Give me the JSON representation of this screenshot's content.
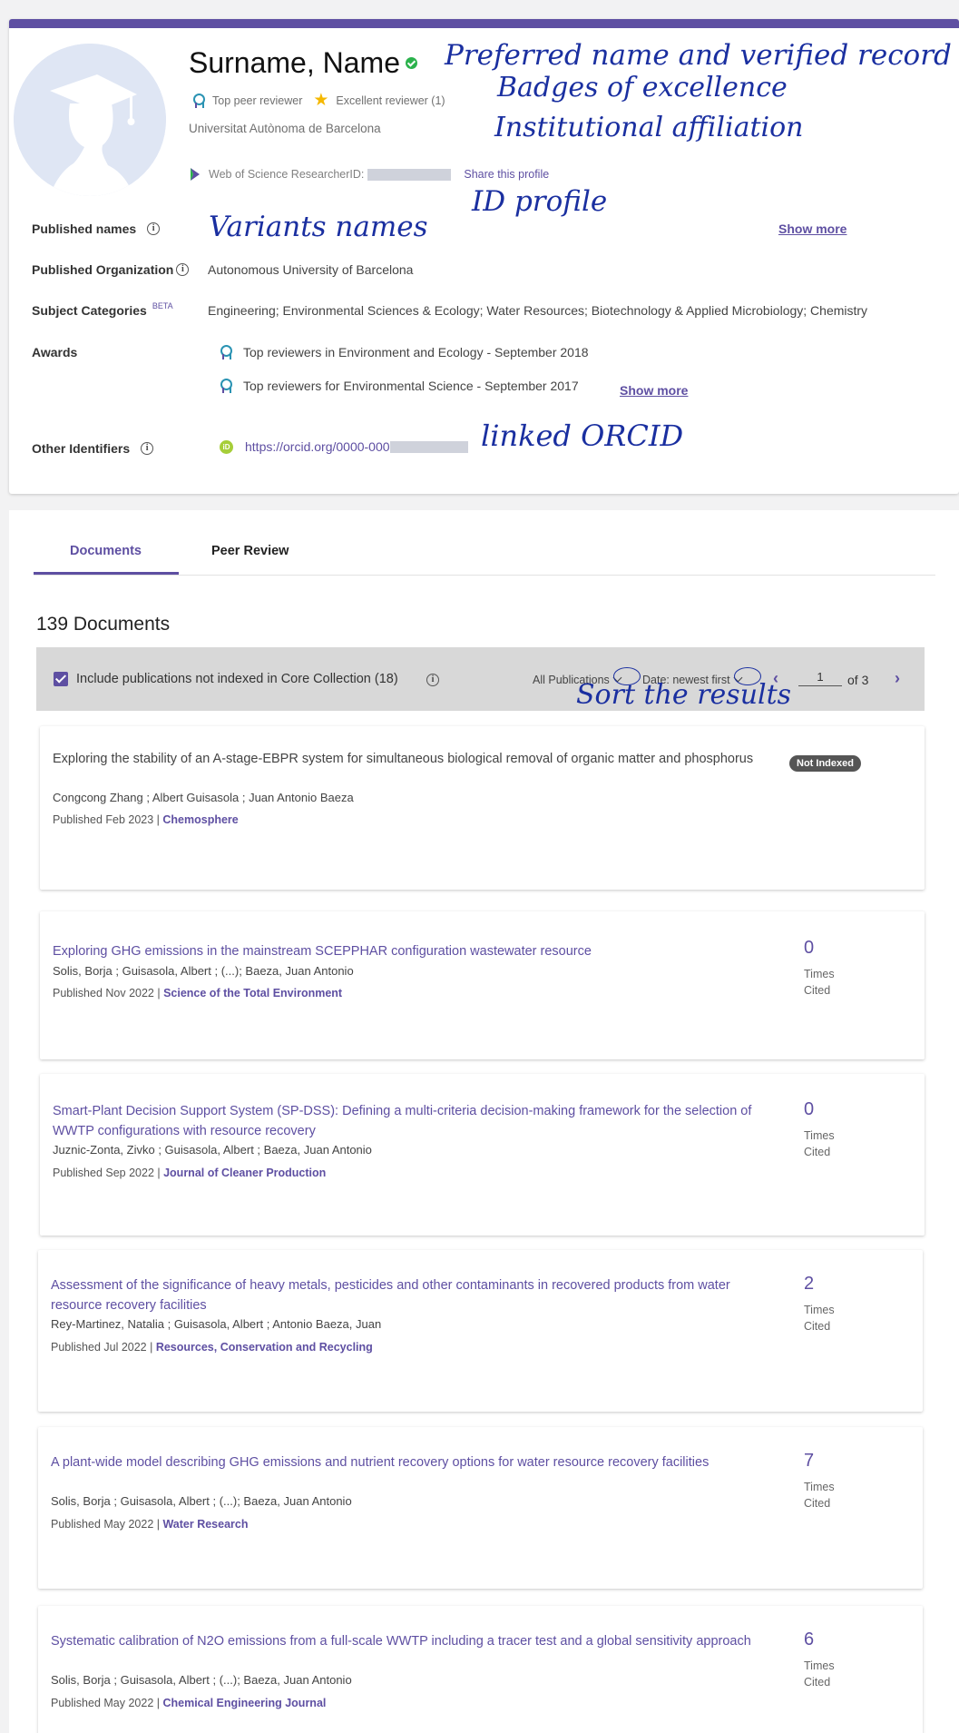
{
  "profile": {
    "name": "Surname, Name",
    "badges": {
      "top_peer": "Top peer reviewer",
      "excellent": "Excellent reviewer (1)"
    },
    "affiliation": "Universitat Autònoma de Barcelona",
    "researcher_id_label": "Web of Science ResearcherID:",
    "share": "Share this profile"
  },
  "details": {
    "published_names_label": "Published names",
    "published_org_label": "Published Organization",
    "published_org_value": "Autonomous University of Barcelona",
    "subject_label": "Subject Categories",
    "beta": "BETA",
    "subjects": "Engineering;  Environmental Sciences & Ecology;  Water Resources;  Biotechnology & Applied Microbiology;  Chemistry",
    "awards_label": "Awards",
    "awards": [
      "Top reviewers in Environment and Ecology - September 2018",
      "Top reviewers for Environmental Science - September 2017"
    ],
    "other_ids_label": "Other Identifiers",
    "orcid_icon": "iD",
    "orcid": "https://orcid.org/0000-000",
    "show_more": "Show more"
  },
  "annotations": {
    "preferred": "Preferred name and verified record",
    "badges": "Badges of excellence",
    "institutional": "Institutional affiliation",
    "id_profile": "ID profile",
    "variants": "Variants names",
    "orcid": "linked ORCID",
    "sort": "Sort the results"
  },
  "tabs": {
    "documents": "Documents",
    "peer_review": "Peer Review"
  },
  "documents": {
    "count": "139 Documents",
    "include_label": "Include publications not indexed in Core Collection (18)",
    "filter": "All Publications",
    "sort": "Date: newest first",
    "page": "1",
    "page_of": "of 3",
    "prev": "‹",
    "next": "›",
    "times": "Times",
    "cited": "Cited",
    "not_indexed": "Not Indexed",
    "items": [
      {
        "title": "Exploring the stability of an A-stage-EBPR system for simultaneous biological removal of organic matter and phosphorus",
        "authors": "Congcong Zhang ; Albert Guisasola ; Juan Antonio Baeza",
        "published": "Published Feb 2023 | ",
        "journal": "Chemosphere"
      },
      {
        "title": "Exploring GHG emissions in the mainstream SCEPPHAR configuration wastewater resource",
        "authors": "Solis, Borja ; Guisasola, Albert ; (...); Baeza, Juan Antonio",
        "published": "Published Nov 2022 | ",
        "journal": "Science of the Total Environment",
        "cites": "0"
      },
      {
        "title": "Smart-Plant Decision Support System (SP-DSS): Defining a multi-criteria decision-making framework for the selection of WWTP configurations with resource recovery",
        "authors": "Juznic-Zonta, Zivko ; Guisasola, Albert ; Baeza, Juan Antonio",
        "published": "Published Sep 2022 | ",
        "journal": "Journal of Cleaner Production",
        "cites": "0"
      },
      {
        "title": "Assessment of the significance of heavy metals, pesticides and other contaminants in recovered products from water resource recovery facilities",
        "authors": "Rey-Martinez, Natalia ; Guisasola, Albert ; Antonio Baeza, Juan",
        "published": "Published Jul 2022 | ",
        "journal": "Resources, Conservation and Recycling",
        "cites": "2"
      },
      {
        "title": "A plant-wide model describing GHG emissions and nutrient recovery options for water resource recovery facilities",
        "authors": "Solis, Borja ; Guisasola, Albert ; (...); Baeza, Juan Antonio",
        "published": "Published May 2022 | ",
        "journal": "Water Research",
        "cites": "7"
      },
      {
        "title": "Systematic calibration of N2O emissions from a full-scale WWTP including a tracer test and a global sensitivity approach",
        "authors": "Solis, Borja ; Guisasola, Albert ; (...); Baeza, Juan Antonio",
        "published": "Published May 2022 | ",
        "journal": "Chemical Engineering Journal",
        "cites": "6"
      }
    ]
  },
  "colors": {
    "accent": "#5e4fa2",
    "annotation": "#1a2fa0",
    "verified": "#2bb24c",
    "star": "#f5b800"
  }
}
